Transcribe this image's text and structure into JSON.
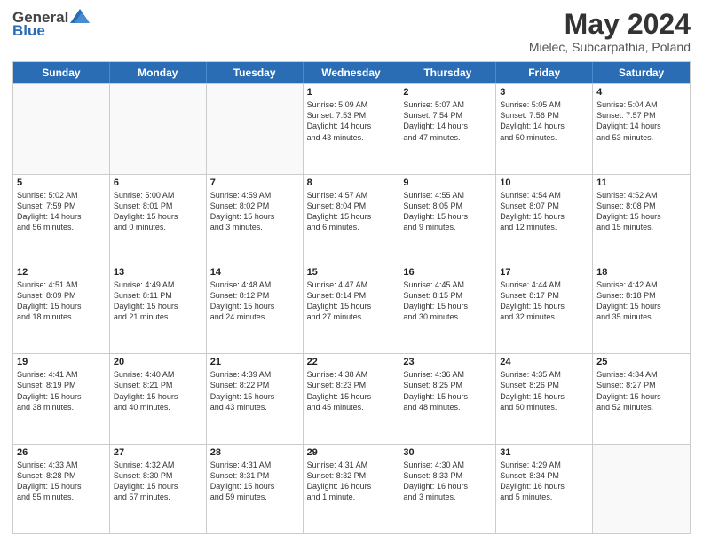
{
  "header": {
    "logo_general": "General",
    "logo_blue": "Blue",
    "title": "May 2024",
    "subtitle": "Mielec, Subcarpathia, Poland"
  },
  "weekdays": [
    "Sunday",
    "Monday",
    "Tuesday",
    "Wednesday",
    "Thursday",
    "Friday",
    "Saturday"
  ],
  "weeks": [
    [
      {
        "day": "",
        "lines": []
      },
      {
        "day": "",
        "lines": []
      },
      {
        "day": "",
        "lines": []
      },
      {
        "day": "1",
        "lines": [
          "Sunrise: 5:09 AM",
          "Sunset: 7:53 PM",
          "Daylight: 14 hours",
          "and 43 minutes."
        ]
      },
      {
        "day": "2",
        "lines": [
          "Sunrise: 5:07 AM",
          "Sunset: 7:54 PM",
          "Daylight: 14 hours",
          "and 47 minutes."
        ]
      },
      {
        "day": "3",
        "lines": [
          "Sunrise: 5:05 AM",
          "Sunset: 7:56 PM",
          "Daylight: 14 hours",
          "and 50 minutes."
        ]
      },
      {
        "day": "4",
        "lines": [
          "Sunrise: 5:04 AM",
          "Sunset: 7:57 PM",
          "Daylight: 14 hours",
          "and 53 minutes."
        ]
      }
    ],
    [
      {
        "day": "5",
        "lines": [
          "Sunrise: 5:02 AM",
          "Sunset: 7:59 PM",
          "Daylight: 14 hours",
          "and 56 minutes."
        ]
      },
      {
        "day": "6",
        "lines": [
          "Sunrise: 5:00 AM",
          "Sunset: 8:01 PM",
          "Daylight: 15 hours",
          "and 0 minutes."
        ]
      },
      {
        "day": "7",
        "lines": [
          "Sunrise: 4:59 AM",
          "Sunset: 8:02 PM",
          "Daylight: 15 hours",
          "and 3 minutes."
        ]
      },
      {
        "day": "8",
        "lines": [
          "Sunrise: 4:57 AM",
          "Sunset: 8:04 PM",
          "Daylight: 15 hours",
          "and 6 minutes."
        ]
      },
      {
        "day": "9",
        "lines": [
          "Sunrise: 4:55 AM",
          "Sunset: 8:05 PM",
          "Daylight: 15 hours",
          "and 9 minutes."
        ]
      },
      {
        "day": "10",
        "lines": [
          "Sunrise: 4:54 AM",
          "Sunset: 8:07 PM",
          "Daylight: 15 hours",
          "and 12 minutes."
        ]
      },
      {
        "day": "11",
        "lines": [
          "Sunrise: 4:52 AM",
          "Sunset: 8:08 PM",
          "Daylight: 15 hours",
          "and 15 minutes."
        ]
      }
    ],
    [
      {
        "day": "12",
        "lines": [
          "Sunrise: 4:51 AM",
          "Sunset: 8:09 PM",
          "Daylight: 15 hours",
          "and 18 minutes."
        ]
      },
      {
        "day": "13",
        "lines": [
          "Sunrise: 4:49 AM",
          "Sunset: 8:11 PM",
          "Daylight: 15 hours",
          "and 21 minutes."
        ]
      },
      {
        "day": "14",
        "lines": [
          "Sunrise: 4:48 AM",
          "Sunset: 8:12 PM",
          "Daylight: 15 hours",
          "and 24 minutes."
        ]
      },
      {
        "day": "15",
        "lines": [
          "Sunrise: 4:47 AM",
          "Sunset: 8:14 PM",
          "Daylight: 15 hours",
          "and 27 minutes."
        ]
      },
      {
        "day": "16",
        "lines": [
          "Sunrise: 4:45 AM",
          "Sunset: 8:15 PM",
          "Daylight: 15 hours",
          "and 30 minutes."
        ]
      },
      {
        "day": "17",
        "lines": [
          "Sunrise: 4:44 AM",
          "Sunset: 8:17 PM",
          "Daylight: 15 hours",
          "and 32 minutes."
        ]
      },
      {
        "day": "18",
        "lines": [
          "Sunrise: 4:42 AM",
          "Sunset: 8:18 PM",
          "Daylight: 15 hours",
          "and 35 minutes."
        ]
      }
    ],
    [
      {
        "day": "19",
        "lines": [
          "Sunrise: 4:41 AM",
          "Sunset: 8:19 PM",
          "Daylight: 15 hours",
          "and 38 minutes."
        ]
      },
      {
        "day": "20",
        "lines": [
          "Sunrise: 4:40 AM",
          "Sunset: 8:21 PM",
          "Daylight: 15 hours",
          "and 40 minutes."
        ]
      },
      {
        "day": "21",
        "lines": [
          "Sunrise: 4:39 AM",
          "Sunset: 8:22 PM",
          "Daylight: 15 hours",
          "and 43 minutes."
        ]
      },
      {
        "day": "22",
        "lines": [
          "Sunrise: 4:38 AM",
          "Sunset: 8:23 PM",
          "Daylight: 15 hours",
          "and 45 minutes."
        ]
      },
      {
        "day": "23",
        "lines": [
          "Sunrise: 4:36 AM",
          "Sunset: 8:25 PM",
          "Daylight: 15 hours",
          "and 48 minutes."
        ]
      },
      {
        "day": "24",
        "lines": [
          "Sunrise: 4:35 AM",
          "Sunset: 8:26 PM",
          "Daylight: 15 hours",
          "and 50 minutes."
        ]
      },
      {
        "day": "25",
        "lines": [
          "Sunrise: 4:34 AM",
          "Sunset: 8:27 PM",
          "Daylight: 15 hours",
          "and 52 minutes."
        ]
      }
    ],
    [
      {
        "day": "26",
        "lines": [
          "Sunrise: 4:33 AM",
          "Sunset: 8:28 PM",
          "Daylight: 15 hours",
          "and 55 minutes."
        ]
      },
      {
        "day": "27",
        "lines": [
          "Sunrise: 4:32 AM",
          "Sunset: 8:30 PM",
          "Daylight: 15 hours",
          "and 57 minutes."
        ]
      },
      {
        "day": "28",
        "lines": [
          "Sunrise: 4:31 AM",
          "Sunset: 8:31 PM",
          "Daylight: 15 hours",
          "and 59 minutes."
        ]
      },
      {
        "day": "29",
        "lines": [
          "Sunrise: 4:31 AM",
          "Sunset: 8:32 PM",
          "Daylight: 16 hours",
          "and 1 minute."
        ]
      },
      {
        "day": "30",
        "lines": [
          "Sunrise: 4:30 AM",
          "Sunset: 8:33 PM",
          "Daylight: 16 hours",
          "and 3 minutes."
        ]
      },
      {
        "day": "31",
        "lines": [
          "Sunrise: 4:29 AM",
          "Sunset: 8:34 PM",
          "Daylight: 16 hours",
          "and 5 minutes."
        ]
      },
      {
        "day": "",
        "lines": []
      }
    ]
  ]
}
